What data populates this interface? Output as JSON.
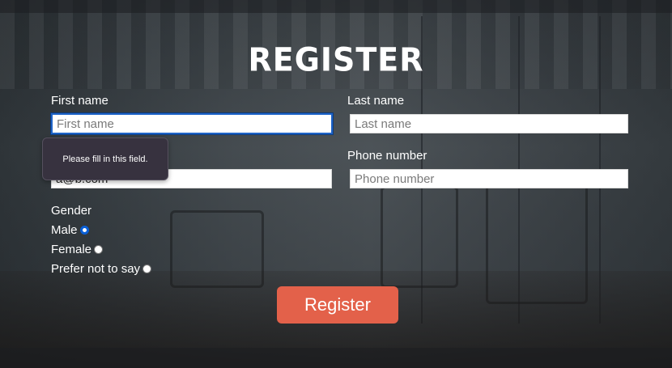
{
  "form": {
    "title": "REGISTER",
    "first_name": {
      "label": "First name",
      "placeholder": "First name",
      "value": ""
    },
    "last_name": {
      "label": "Last name",
      "placeholder": "Last name",
      "value": ""
    },
    "email": {
      "value": "a@b.com"
    },
    "phone": {
      "label": "Phone number",
      "placeholder": "Phone number",
      "value": ""
    },
    "gender": {
      "label": "Gender",
      "options": [
        {
          "label": "Male",
          "checked": true
        },
        {
          "label": "Female",
          "checked": false
        },
        {
          "label": "Prefer not to say",
          "checked": false
        }
      ]
    },
    "submit_label": "Register"
  },
  "validation": {
    "message": "Please fill in this field."
  },
  "colors": {
    "accent": "#e3614a",
    "focus": "#1f64c8",
    "radio_checked": "#0a5fd6"
  }
}
